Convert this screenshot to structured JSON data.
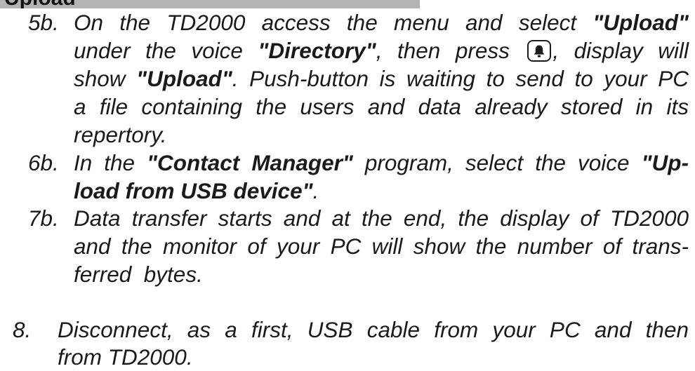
{
  "header": {
    "title": "Upload"
  },
  "steps": {
    "s5b": {
      "num": "5b.",
      "l1_a": "On the TD2000 access the menu and select ",
      "l1_b": "\"Upload\"",
      "l2_a": "under the voice ",
      "l2_b": "\"Directory\"",
      "l2_c": ", then press ",
      "l2_d": ", display will",
      "l3_a": "show ",
      "l3_b": "\"Upload\"",
      "l3_c": ". Push-button is waiting to send to your PC",
      "l4": "a file containing the users and data already stored in its",
      "l5": "repertory."
    },
    "s6b": {
      "num": "6b.",
      "l1_a": "In the ",
      "l1_b": "\"Contact Manager\"",
      "l1_c": " program, select the voice ",
      "l1_d": "\"Up-",
      "l2": "load from USB device\"",
      "l2_end": "."
    },
    "s7b": {
      "num": "7b.",
      "l1": "Data transfer starts and at the end, the display of TD2000",
      "l2": "and the monitor of your PC will show the number of trans-",
      "l3": "ferred  bytes."
    },
    "s8": {
      "num": "8.",
      "l1": "Disconnect, as a first, USB cable from your PC and then",
      "l2": "from TD2000."
    }
  },
  "icons": {
    "key": "bell-icon"
  }
}
